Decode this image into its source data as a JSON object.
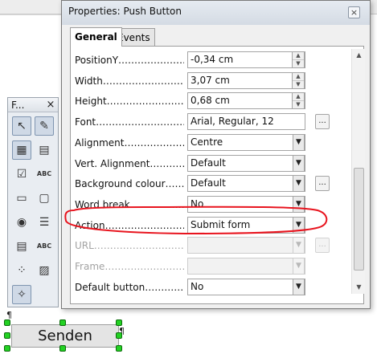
{
  "dialog": {
    "title": "Properties: Push Button",
    "close_glyph": "×",
    "tabs": [
      {
        "label": "General",
        "active": true
      },
      {
        "label": "Events",
        "active": false
      }
    ],
    "rows": [
      {
        "label": "PositionY…………………………",
        "value": "-0,34 cm",
        "control": "spin"
      },
      {
        "label": "Width……………………………",
        "value": "3,07 cm",
        "control": "spin"
      },
      {
        "label": "Height……………………………",
        "value": "0,68 cm",
        "control": "spin"
      },
      {
        "label": "Font…………………………………",
        "value": "Arial, Regular, 12",
        "control": "dots"
      },
      {
        "label": "Alignment…………………………",
        "value": "Centre",
        "control": "drop"
      },
      {
        "label": "Vert. Alignment……………",
        "value": "Default",
        "control": "drop"
      },
      {
        "label": "Background colour……………",
        "value": "Default",
        "control": "drop+dots"
      },
      {
        "label": "Word break…………………………",
        "value": "No",
        "control": "drop"
      },
      {
        "label": "Action……………………………",
        "value": "Submit form",
        "control": "drop"
      },
      {
        "label": "URL………………………………",
        "value": "",
        "control": "drop+dots",
        "disabled": true
      },
      {
        "label": "Frame……………………………",
        "value": "",
        "control": "drop",
        "disabled": true
      },
      {
        "label": "Default button…………………",
        "value": "No",
        "control": "drop"
      }
    ],
    "dots_label": "..."
  },
  "toolbar": {
    "title": "F...",
    "close_glyph": "×",
    "icons": [
      {
        "name": "select-icon",
        "glyph": "↖",
        "on": true
      },
      {
        "name": "design-mode-icon",
        "glyph": "✎",
        "on": true
      },
      {
        "name": "form-design-icon",
        "glyph": "▦",
        "on": true
      },
      {
        "name": "form-navigator-icon",
        "glyph": "▤",
        "on": false
      },
      {
        "name": "checkbox-icon",
        "glyph": "☑",
        "on": false
      },
      {
        "name": "label-icon",
        "glyph": "ABC",
        "on": false
      },
      {
        "name": "text-box-icon",
        "glyph": "▭",
        "on": false
      },
      {
        "name": "button-icon",
        "glyph": "▢",
        "on": false
      },
      {
        "name": "option-button-icon",
        "glyph": "◉",
        "on": false
      },
      {
        "name": "list-box-icon",
        "glyph": "☰",
        "on": false
      },
      {
        "name": "combo-box-icon",
        "glyph": "▤",
        "on": false
      },
      {
        "name": "formatted-field-icon",
        "glyph": "ABC",
        "on": false
      },
      {
        "name": "more-controls-icon",
        "glyph": "⁘",
        "on": false
      },
      {
        "name": "image-control-icon",
        "glyph": "▨",
        "on": false
      },
      {
        "name": "wizards-icon",
        "glyph": "✧",
        "on": true
      }
    ]
  },
  "document": {
    "button_label": "Senden",
    "anchor_glyph": "¶"
  },
  "colors": {
    "annotation_red": "#e8141e",
    "handle_green": "#23d123"
  }
}
